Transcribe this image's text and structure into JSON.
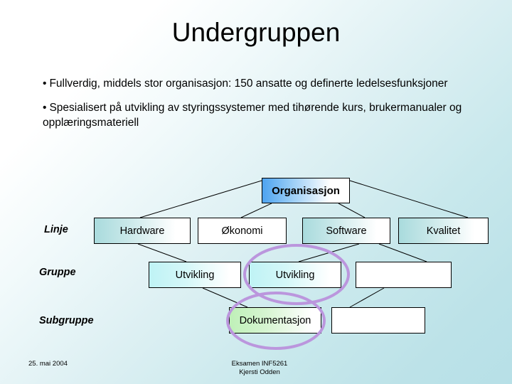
{
  "slide": {
    "title": "Undergruppen",
    "bullet_mark": "•",
    "bullets": [
      "Fullverdig, middels stor organisasjon: 150 ansatte og definerte ledelsesfunksjoner",
      "Spesialisert på utvikling av styringssystemer med tihørende kurs, brukermanualer og opplæringsmateriell"
    ]
  },
  "diagram": {
    "root": {
      "label": "Organisasjon"
    },
    "row_labels": [
      {
        "label": "Linje"
      },
      {
        "label": "Gruppe"
      },
      {
        "label": "Subgruppe"
      }
    ],
    "linje_nodes": [
      {
        "label": "Hardware"
      },
      {
        "label": "Økonomi"
      },
      {
        "label": "Software"
      },
      {
        "label": "Kvalitet"
      }
    ],
    "gruppe_nodes": [
      {
        "label": "Utvikling"
      },
      {
        "label": "Utvikling"
      },
      {
        "label": ""
      }
    ],
    "subgruppe_nodes": [
      {
        "label": "Dokumentasjon"
      },
      {
        "label": ""
      }
    ],
    "highlight_color": "#bb96dd",
    "line_color": "#000000"
  },
  "footer": {
    "date": "25. mai 2004",
    "exam": "Eksamen INF5261",
    "author": "Kjersti Odden"
  }
}
